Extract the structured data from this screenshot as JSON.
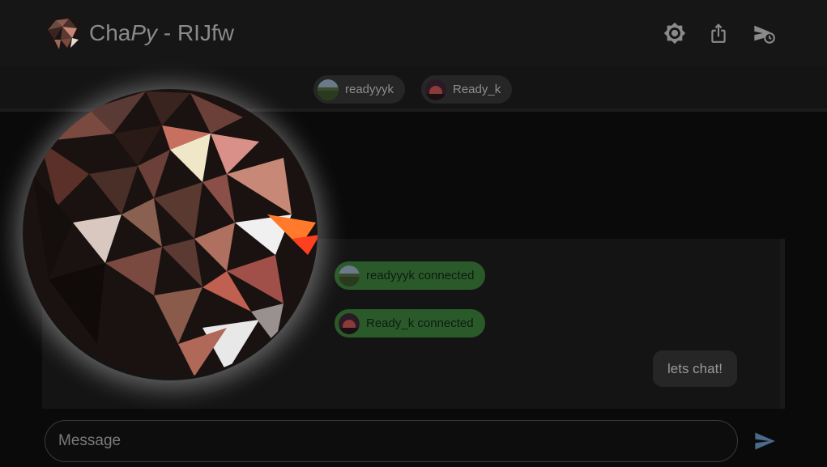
{
  "header": {
    "title_prefix": "Cha",
    "title_py": "Py",
    "title_suffix": " - RIJfw",
    "icons": [
      "brightness-icon",
      "share-icon",
      "scheduled-send-icon"
    ]
  },
  "users": [
    {
      "name": "readyyyk"
    },
    {
      "name": "Ready_k"
    }
  ],
  "events": [
    {
      "text": "readyyyk connected"
    },
    {
      "text": "Ready_k connected"
    }
  ],
  "messages": [
    {
      "text": "lets chat!"
    }
  ],
  "composer": {
    "placeholder": "Message"
  },
  "colors": {
    "header_bg": "#161616",
    "pill_green": "#2a5a2a",
    "send_blue": "#4a6a8a"
  }
}
